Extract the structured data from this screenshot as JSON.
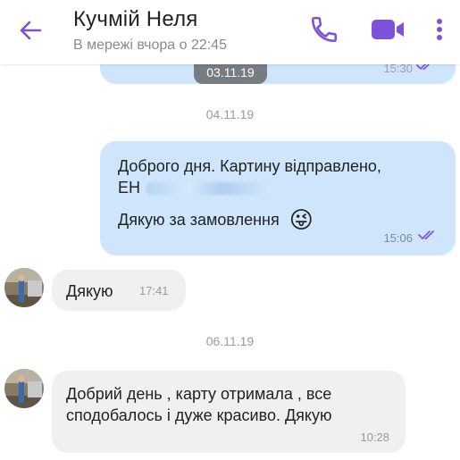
{
  "header": {
    "contact_name": "Кучмій Неля",
    "status": "В мережі вчора о 22:45",
    "icons": [
      "back-arrow-icon",
      "phone-icon",
      "video-camera-icon",
      "more-vertical-icon"
    ],
    "accent_color": "#7b52d9"
  },
  "chat": {
    "previous_message": {
      "time": "15:30"
    },
    "sticky_date": "03.11.19",
    "date_separators": [
      "04.11.19",
      "06.11.19"
    ],
    "messages": [
      {
        "direction": "outgoing",
        "line1": "Доброго дня. Картину відправлено,",
        "line2_prefix": "ЕН",
        "line3": "Дякую за замовлення",
        "emoji": "😜",
        "time": "15:06"
      },
      {
        "direction": "incoming",
        "text": "Дякую",
        "time": "17:41"
      },
      {
        "direction": "incoming",
        "line1": "Добрий день , карту отримала , все",
        "line2": "сподобалось і дуже красиво. Дякую",
        "time": "10:28"
      }
    ],
    "colors": {
      "outgoing_bubble": "#cfe5fb",
      "incoming_bubble": "#f0f0f0",
      "ticks": "#7b52d9"
    }
  }
}
